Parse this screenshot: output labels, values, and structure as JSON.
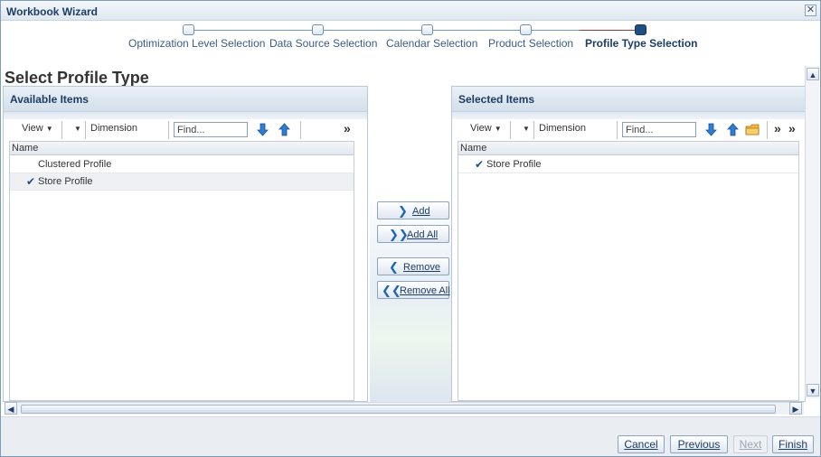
{
  "window": {
    "title": "Workbook Wizard",
    "close_glyph": "✕"
  },
  "train": {
    "steps": [
      {
        "label": "Optimization Level Selection",
        "current": false
      },
      {
        "label": "Data Source Selection",
        "current": false
      },
      {
        "label": "Calendar Selection",
        "current": false
      },
      {
        "label": "Product Selection",
        "current": false
      },
      {
        "label": "Profile Type Selection",
        "current": true
      }
    ]
  },
  "page_title": "Select Profile Type",
  "available": {
    "title": "Available Items",
    "toolbar": {
      "view_label": "View",
      "dimension_label": "Dimension",
      "find_placeholder": "Find...",
      "more": "»"
    },
    "column": "Name",
    "rows": [
      {
        "label": "Clustered Profile",
        "checked": false,
        "selected": false
      },
      {
        "label": "Store Profile",
        "checked": true,
        "selected": true
      }
    ]
  },
  "selected": {
    "title": "Selected Items",
    "toolbar": {
      "view_label": "View",
      "dimension_label": "Dimension",
      "find_placeholder": "Find...",
      "more": "»",
      "more2": "»"
    },
    "column": "Name",
    "rows": [
      {
        "label": "Store Profile",
        "checked": true,
        "selected": false
      }
    ]
  },
  "shuttle": {
    "add": "Add",
    "add_all": "Add All",
    "remove": "Remove",
    "remove_all": "Remove All",
    "add_arrow": "❯",
    "add_all_arrow": "❯❯",
    "remove_arrow": "❮",
    "remove_all_arrow": "❮❮"
  },
  "scroll": {
    "up": "▲",
    "down": "▼",
    "left": "◀",
    "right": "▶"
  },
  "footer": {
    "cancel": "Cancel",
    "previous": "Previous",
    "next": "Next",
    "finish": "Finish"
  },
  "colors": {
    "accent": "#1d4f85",
    "arrow_blue": "#1f63b6",
    "title_blue": "#1e3d63"
  },
  "icons": [
    "close-icon",
    "move-down-icon",
    "move-up-icon",
    "folder-icon",
    "check-icon"
  ]
}
